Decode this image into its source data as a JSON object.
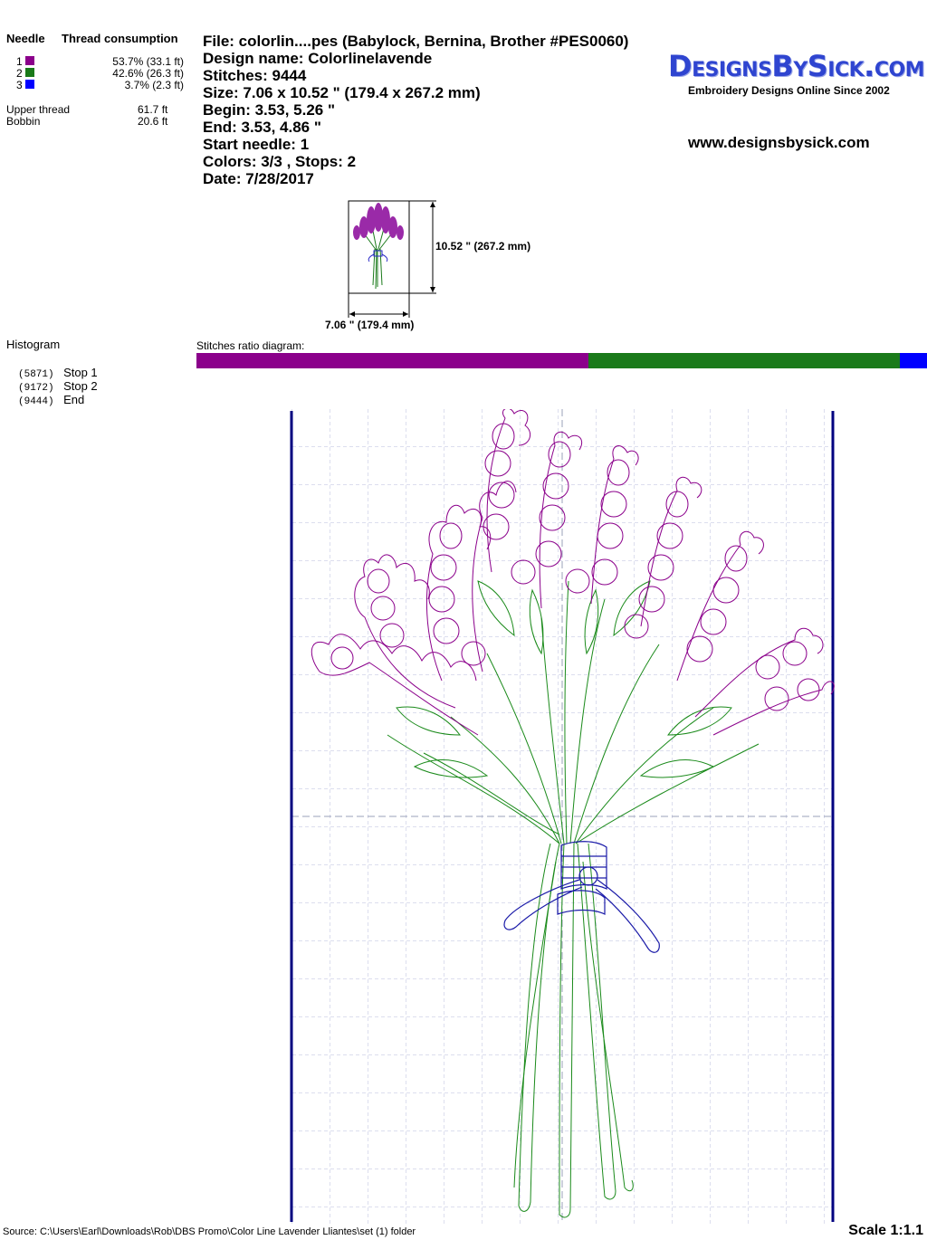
{
  "needle_table": {
    "col_needle": "Needle",
    "col_thread": "Thread consumption",
    "rows": [
      {
        "num": "1",
        "color": "#8b008b",
        "value": "53.7% (33.1 ft)"
      },
      {
        "num": "2",
        "color": "#1a7a1a",
        "value": "42.6% (26.3 ft)"
      },
      {
        "num": "3",
        "color": "#0000ff",
        "value": "3.7% (2.3 ft)"
      }
    ],
    "upper_label": "Upper thread",
    "upper_value": "61.7 ft",
    "bobbin_label": "Bobbin",
    "bobbin_value": "20.6 ft"
  },
  "info": {
    "file": "File: colorlin....pes  (Babylock, Bernina, Brother #PES0060)",
    "design_name": "Design name: Colorlinelavende",
    "stitches": "Stitches: 9444",
    "size": "Size: 7.06 x 10.52 \" (179.4 x 267.2 mm)",
    "begin": "Begin: 3.53, 5.26 \"",
    "end": "End: 3.53, 4.86 \"",
    "start_needle": "Start needle: 1",
    "colors_stops": "Colors: 3/3 , Stops: 2",
    "date": "Date: 7/28/2017"
  },
  "logo": {
    "brand": "DesignsBySick.com",
    "tagline": "Embroidery Designs Online Since 2002",
    "url": "www.designsbysick.com"
  },
  "thumbnail": {
    "height_label": "10.52 \" (267.2 mm)",
    "width_label": "7.06 \" (179.4 mm)"
  },
  "histogram": {
    "title": "Histogram",
    "entries": [
      {
        "count": "(5871)",
        "label": "Stop 1"
      },
      {
        "count": "(9172)",
        "label": "Stop 2"
      },
      {
        "count": "(9444)",
        "label": "End"
      }
    ]
  },
  "ratio": {
    "title": "Stitches ratio diagram:",
    "segments": [
      {
        "color": "#8b008b",
        "fraction": 0.537
      },
      {
        "color": "#1a7a1a",
        "fraction": 0.426
      },
      {
        "color": "#0000ff",
        "fraction": 0.037
      }
    ]
  },
  "footer": {
    "source": "Source: C:\\Users\\Earl\\Downloads\\Rob\\DBS Promo\\Color Line Lavender  Lliantes\\set (1) folder",
    "scale": "Scale 1:1.1"
  }
}
